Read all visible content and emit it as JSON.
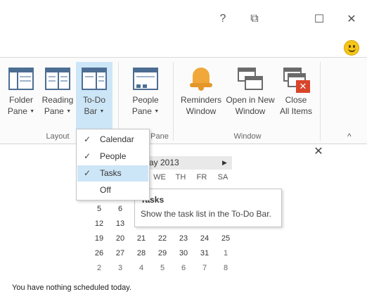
{
  "window_controls": {
    "help": "?",
    "restore_down": "⧉",
    "maximize": "☐",
    "close": "✕"
  },
  "ribbon": {
    "folder_pane": {
      "line1": "Folder",
      "line2": "Pane"
    },
    "reading_pane": {
      "line1": "Reading",
      "line2": "Pane"
    },
    "todo_bar": {
      "line1": "To-Do",
      "line2": "Bar"
    },
    "people_pane": {
      "line1": "People",
      "line2": "Pane"
    },
    "reminders_window": {
      "line1": "Reminders",
      "line2": "Window"
    },
    "open_new_window": {
      "line1": "Open in New",
      "line2": "Window"
    },
    "close_all_items": {
      "line1": "Close",
      "line2": "All Items"
    },
    "groups": {
      "layout": "Layout",
      "people_pane_partial": "Pane",
      "window": "Window"
    },
    "collapse_icon": "^"
  },
  "todo_menu": {
    "items": [
      {
        "label": "Calendar",
        "checked": true,
        "highlighted": false
      },
      {
        "label": "People",
        "checked": true,
        "highlighted": false
      },
      {
        "label": "Tasks",
        "checked": true,
        "highlighted": true
      },
      {
        "label": "Off",
        "checked": false,
        "highlighted": false
      }
    ],
    "check_glyph": "✓"
  },
  "tooltip": {
    "title": "Tasks",
    "body": "Show the task list in the To-Do Bar."
  },
  "calendar": {
    "month_header_visible": "ay 2013",
    "next_arrow": "▶",
    "days_of_week_visible": [
      "WE",
      "TH",
      "FR",
      "SA"
    ],
    "rows": [
      [
        "5",
        "6",
        "",
        "",
        "",
        "",
        ""
      ],
      [
        "12",
        "13",
        "",
        "",
        "",
        "",
        ""
      ],
      [
        "19",
        "20",
        "21",
        "22",
        "23",
        "24",
        "25"
      ],
      [
        "26",
        "27",
        "28",
        "29",
        "30",
        "31",
        "1"
      ],
      [
        "2",
        "3",
        "4",
        "5",
        "6",
        "7",
        "8"
      ]
    ]
  },
  "pane_close": "✕",
  "status_text": "You have nothing scheduled today."
}
